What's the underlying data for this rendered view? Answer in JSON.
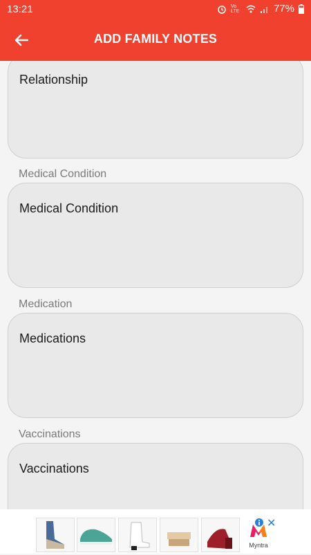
{
  "status_bar": {
    "time": "13:21",
    "net_label": "Vo LTE",
    "battery": "77%"
  },
  "toolbar": {
    "title": "ADD FAMILY NOTES"
  },
  "form": {
    "relationship": {
      "value": "Relationship"
    },
    "medical_condition": {
      "label": "Medical Condition",
      "value": "Medical Condition"
    },
    "medication": {
      "label": "Medication",
      "value": "Medications"
    },
    "vaccinations": {
      "label": "Vaccinations",
      "value": "Vaccinations"
    }
  },
  "ad": {
    "brand": "Myntra",
    "products": [
      "sneaker-floral",
      "sneaker-teal",
      "boot-white",
      "sandal-beige",
      "wedge-red"
    ]
  },
  "colors": {
    "primary": "#f0412f",
    "field_bg": "#e9e9e9"
  }
}
